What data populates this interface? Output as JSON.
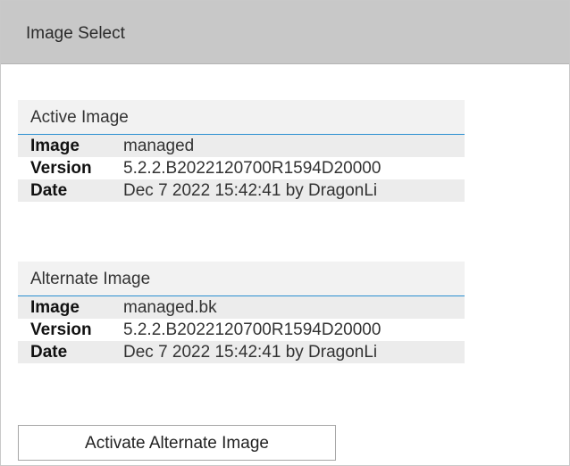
{
  "header": {
    "title": "Image Select"
  },
  "active": {
    "heading": "Active Image",
    "rows": [
      {
        "label": "Image",
        "value": "managed"
      },
      {
        "label": "Version",
        "value": "5.2.2.B2022120700R1594D20000"
      },
      {
        "label": "Date",
        "value": "Dec 7 2022 15:42:41 by DragonLi"
      }
    ]
  },
  "alternate": {
    "heading": "Alternate Image",
    "rows": [
      {
        "label": "Image",
        "value": "managed.bk"
      },
      {
        "label": "Version",
        "value": "5.2.2.B2022120700R1594D20000"
      },
      {
        "label": "Date",
        "value": "Dec 7 2022 15:42:41 by DragonLi"
      }
    ]
  },
  "actions": {
    "activate_label": "Activate Alternate Image"
  }
}
